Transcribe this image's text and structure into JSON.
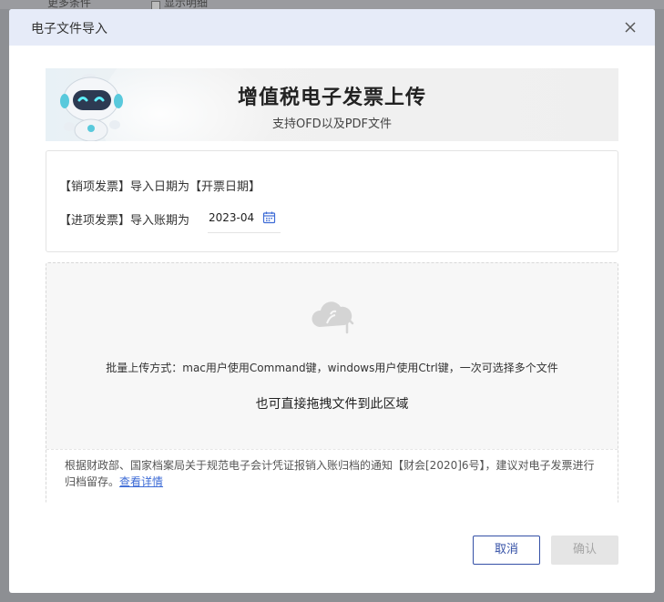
{
  "background": {
    "filter_label": "更多条件",
    "show_detail_label": "显示明细"
  },
  "dialog": {
    "title": "电子文件导入",
    "close_icon": "close-icon"
  },
  "banner": {
    "title": "增值税电子发票上传",
    "subtitle": "支持OFD以及PDF文件",
    "mascot": "robot-mascot"
  },
  "info": {
    "sales_line": "【销项发票】导入日期为【开票日期】",
    "purchase_label": "【进项发票】导入账期为",
    "period_value": "2023-04",
    "calendar_icon": "calendar-icon"
  },
  "upload": {
    "icon": "cloud-upload-icon",
    "batch_hint": "批量上传方式：mac用户使用Command键，windows用户使用Ctrl键，一次可选择多个文件",
    "drag_hint": "也可直接拖拽文件到此区域",
    "notice_text": "根据财政部、国家档案局关于规范电子会计凭证报销入账归档的通知【财会[2020]6号】，建议对电子发票进行归档留存。",
    "notice_link": "查看详情"
  },
  "footer": {
    "cancel_label": "取消",
    "confirm_label": "确认"
  },
  "colors": {
    "header_bg": "#e6ebf8",
    "primary": "#3450a6",
    "link": "#3d6bd6",
    "disabled_bg": "#e5e5e5"
  }
}
